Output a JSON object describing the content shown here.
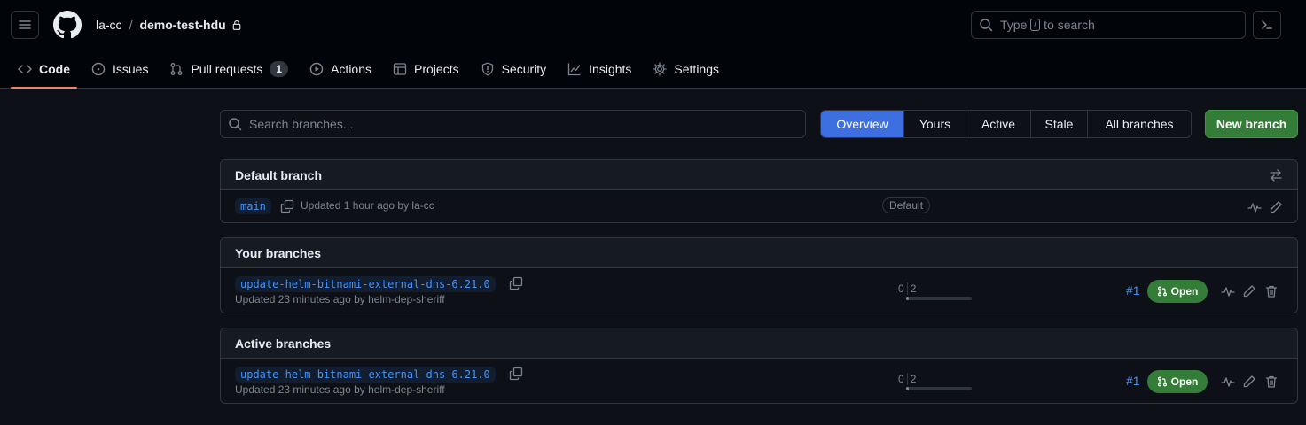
{
  "header": {
    "owner": "la-cc",
    "separator": "/",
    "repo": "demo-test-hdu",
    "search": {
      "prefix": "Type",
      "key": "/",
      "suffix": "to search"
    }
  },
  "nav": [
    {
      "label": "Code",
      "icon": "code-icon",
      "active": true
    },
    {
      "label": "Issues",
      "icon": "issue-icon"
    },
    {
      "label": "Pull requests",
      "icon": "pull-request-icon",
      "count": "1"
    },
    {
      "label": "Actions",
      "icon": "play-icon"
    },
    {
      "label": "Projects",
      "icon": "table-icon"
    },
    {
      "label": "Security",
      "icon": "shield-icon"
    },
    {
      "label": "Insights",
      "icon": "graph-icon"
    },
    {
      "label": "Settings",
      "icon": "gear-icon"
    }
  ],
  "toolbar": {
    "search_placeholder": "Search branches...",
    "filters": [
      "Overview",
      "Yours",
      "Active",
      "Stale",
      "All branches"
    ],
    "selected_filter": "Overview",
    "new_branch": "New branch"
  },
  "default_branch": {
    "title": "Default branch",
    "name": "main",
    "updated": "Updated 1 hour ago by la-cc",
    "label": "Default"
  },
  "your_branches": {
    "title": "Your branches",
    "rows": [
      {
        "name": "update-helm-bitnami-external-dns-6.21.0",
        "updated": "Updated 23 minutes ago by helm-dep-sheriff",
        "behind": "0",
        "ahead": "2",
        "pr": "#1",
        "status": "Open"
      }
    ]
  },
  "active_branches": {
    "title": "Active branches",
    "rows": [
      {
        "name": "update-helm-bitnami-external-dns-6.21.0",
        "updated": "Updated 23 minutes ago by helm-dep-sheriff",
        "behind": "0",
        "ahead": "2",
        "pr": "#1",
        "status": "Open"
      }
    ]
  },
  "colors": {
    "accent": "#4493f8",
    "success": "#347d39",
    "underline": "#f78166"
  }
}
